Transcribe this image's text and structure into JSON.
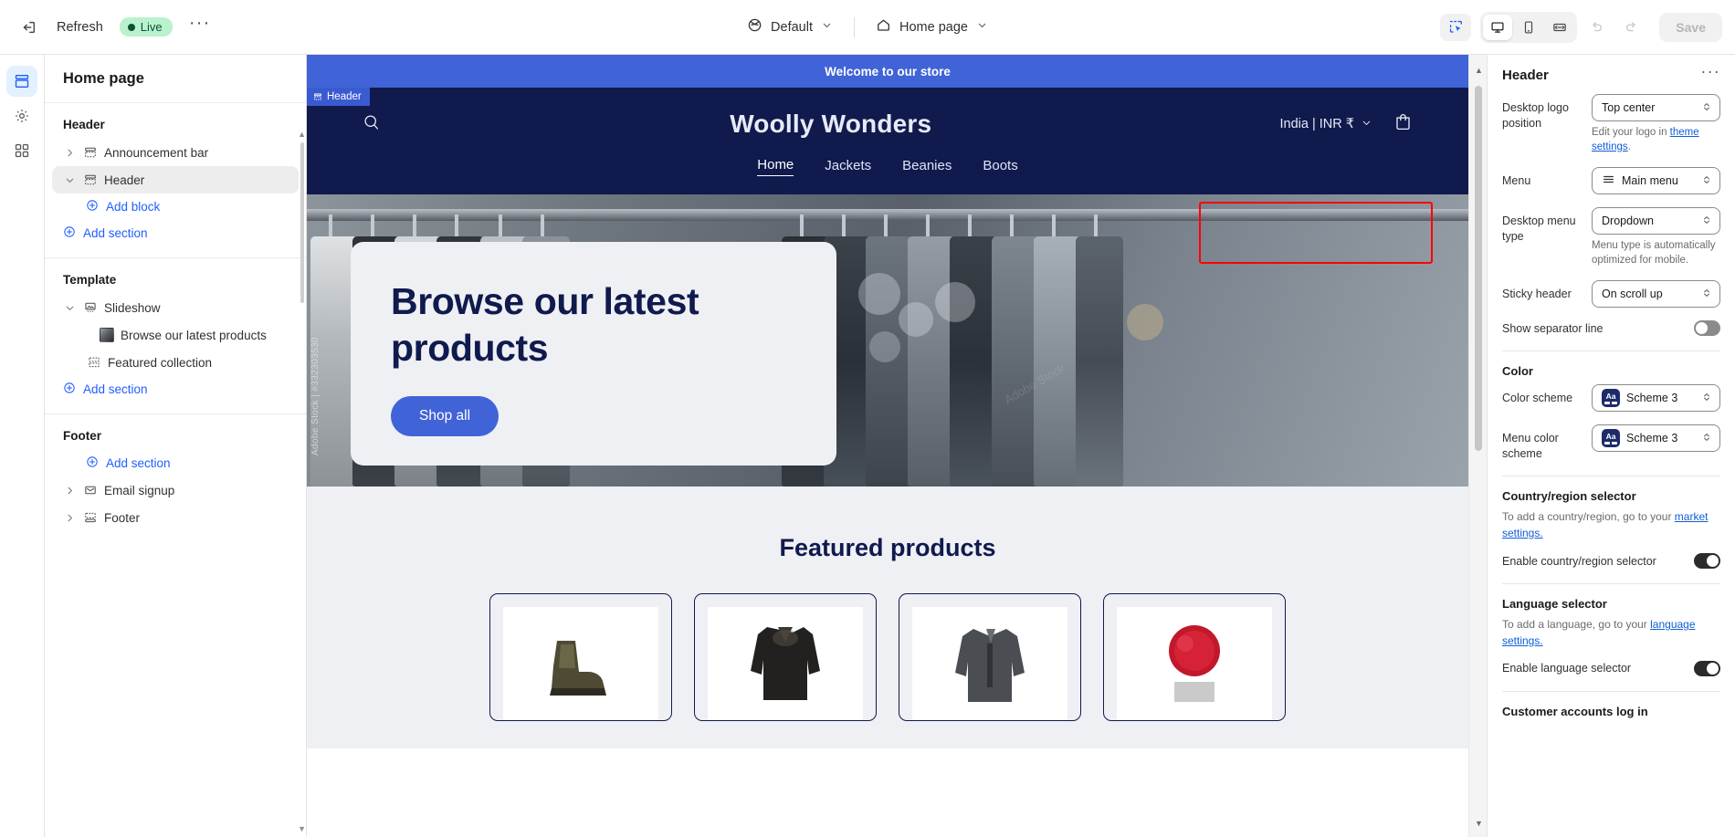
{
  "topbar": {
    "exit_icon": "exit-icon",
    "refresh_label": "Refresh",
    "live_label": "Live",
    "more_label": "···",
    "theme_selector": {
      "icon": "globe-icon",
      "value": "Default"
    },
    "page_selector": {
      "icon": "home-icon",
      "value": "Home page"
    },
    "tools": {
      "select_tool": "select-pointer-icon",
      "desktop": "desktop-icon",
      "mobile": "mobile-icon",
      "fullwidth": "fullwidth-icon",
      "undo": "undo-icon",
      "redo": "redo-icon"
    },
    "save_label": "Save"
  },
  "rail": {
    "items": [
      {
        "name": "sections-icon",
        "active": true
      },
      {
        "name": "settings-gear-icon",
        "active": false
      },
      {
        "name": "apps-blocks-icon",
        "active": false
      }
    ]
  },
  "sidebar": {
    "title": "Home page",
    "groups": [
      {
        "heading": "Header",
        "rows": [
          {
            "label": "Announcement bar",
            "icon": "section-icon",
            "caret": "right",
            "selected": false
          },
          {
            "label": "Header",
            "icon": "section-icon",
            "caret": "down",
            "selected": true
          }
        ],
        "links": [
          {
            "label": "Add block",
            "indent": 1
          },
          {
            "label": "Add section",
            "indent": 0
          }
        ]
      },
      {
        "heading": "Template",
        "rows": [
          {
            "label": "Slideshow",
            "icon": "slideshow-icon",
            "caret": "down",
            "selected": false
          },
          {
            "label": "Browse our latest products",
            "icon": "image-thumb",
            "caret": "none",
            "selected": false,
            "indent": 2
          },
          {
            "label": "Featured collection",
            "icon": "collection-icon",
            "caret": "none",
            "selected": false,
            "indent": 1
          }
        ],
        "links": [
          {
            "label": "Add section",
            "indent": 0
          }
        ]
      },
      {
        "heading": "Footer",
        "links_top": [
          {
            "label": "Add section",
            "indent": 1
          }
        ],
        "rows": [
          {
            "label": "Email signup",
            "icon": "envelope-icon",
            "caret": "right",
            "selected": false
          },
          {
            "label": "Footer",
            "icon": "footer-icon",
            "caret": "right",
            "selected": false
          }
        ]
      }
    ]
  },
  "preview": {
    "section_tag": "Header",
    "announcement": "Welcome to our store",
    "store": {
      "logo": "Woolly Wonders",
      "search_icon": "search-icon",
      "cart_icon": "cart-icon",
      "country": "India | INR ₹",
      "nav": [
        {
          "label": "Home",
          "current": true
        },
        {
          "label": "Jackets",
          "current": false
        },
        {
          "label": "Beanies",
          "current": false
        },
        {
          "label": "Boots",
          "current": false
        }
      ]
    },
    "hero": {
      "heading": "Browse our latest products",
      "button": "Shop all",
      "stock_code": "Adobe Stock | #332303530",
      "watermark": "Adobe Stock"
    },
    "featured": {
      "heading": "Featured products",
      "products": [
        {
          "name": "boots-product"
        },
        {
          "name": "jacket-product"
        },
        {
          "name": "grey-jacket-product"
        },
        {
          "name": "red-pompom-beanie-product"
        }
      ]
    }
  },
  "right_panel": {
    "title": "Header",
    "more_label": "···",
    "desktop_logo_position": {
      "label": "Desktop logo position",
      "value": "Top center",
      "helper_pre": "Edit your logo in ",
      "helper_link": "theme settings",
      "helper_post": "."
    },
    "menu": {
      "label": "Menu",
      "value": "Main menu",
      "icon": "hamburger-icon"
    },
    "desktop_menu_type": {
      "label": "Desktop menu type",
      "value": "Dropdown",
      "helper": "Menu type is automatically optimized for mobile."
    },
    "sticky_header": {
      "label": "Sticky header",
      "value": "On scroll up"
    },
    "show_separator_line": {
      "label": "Show separator line",
      "state": "off"
    },
    "color": {
      "heading": "Color",
      "color_scheme": {
        "label": "Color scheme",
        "value": "Scheme 3",
        "chip": "Aa"
      },
      "menu_color_scheme": {
        "label": "Menu color scheme",
        "value": "Scheme 3",
        "chip": "Aa"
      }
    },
    "country_region": {
      "heading": "Country/region selector",
      "desc_pre": "To add a country/region, go to your ",
      "desc_link": "market settings.",
      "toggle_label": "Enable country/region selector",
      "toggle_state": "on"
    },
    "language": {
      "heading": "Language selector",
      "desc_pre": "To add a language, go to your ",
      "desc_link": "language settings.",
      "toggle_label": "Enable language selector",
      "toggle_state": "on"
    },
    "customer_accounts": {
      "heading": "Customer accounts log in"
    }
  },
  "colors": {
    "accent_blue": "#4163d8",
    "navy": "#101a4d",
    "link": "#1f5eff",
    "live_green": "#b9f2cd",
    "highlight_red": "#ff0000"
  }
}
